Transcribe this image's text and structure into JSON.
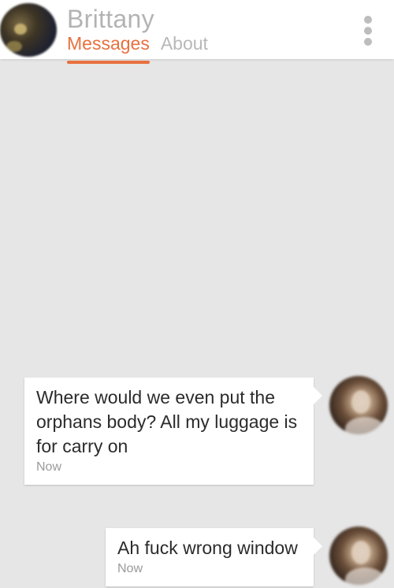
{
  "header": {
    "contact_name": "Brittany",
    "tabs": [
      {
        "label": "Messages",
        "active": true
      },
      {
        "label": "About",
        "active": false
      }
    ],
    "menu_icon": "more-vertical-icon"
  },
  "colors": {
    "accent": "#e8703f",
    "background": "#e6e6e6",
    "bubble": "#ffffff",
    "muted_text": "#b3b3b3"
  },
  "messages": [
    {
      "text": "Where would we even put the orphans body? All my luggage is for carry on",
      "time": "Now"
    },
    {
      "text": "Ah fuck wrong window",
      "time": "Now"
    }
  ]
}
